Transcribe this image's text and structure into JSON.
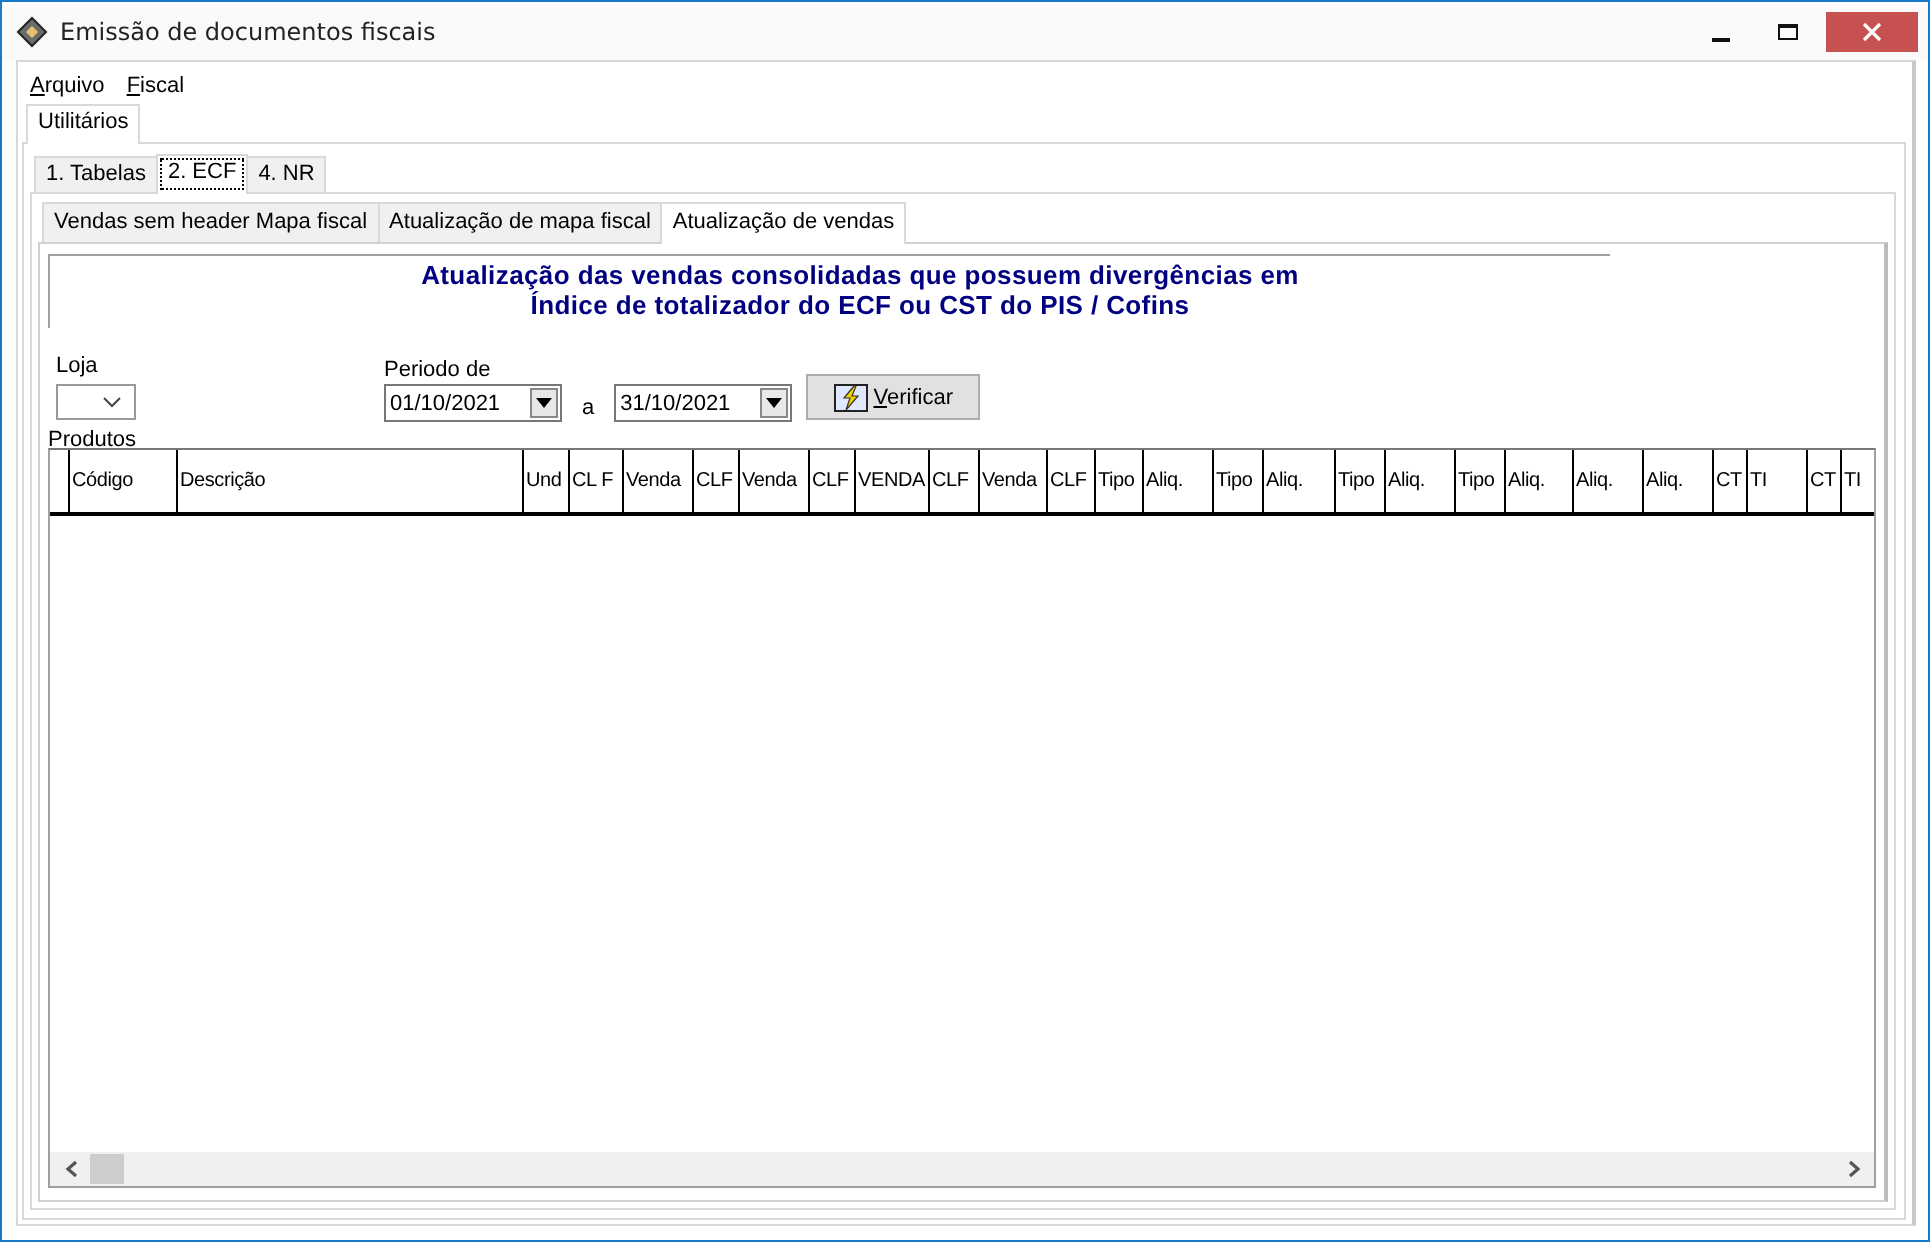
{
  "window": {
    "title": "Emissão de documentos fiscais"
  },
  "menu": [
    "Arquivo",
    "Fiscal"
  ],
  "outer_tabs": [
    {
      "label": "Utilitários",
      "selected": true
    }
  ],
  "tabs": [
    {
      "label": "1. Tabelas",
      "selected": false
    },
    {
      "label": "2. ECF",
      "selected": true
    },
    {
      "label": "4. NR",
      "selected": false
    }
  ],
  "subtabs": [
    {
      "label": "Vendas sem header Mapa fiscal",
      "selected": false
    },
    {
      "label": "Atualização de mapa fiscal",
      "selected": false
    },
    {
      "label": "Atualização de vendas",
      "selected": true
    }
  ],
  "heading": [
    "Atualização das vendas consolidadas que possuem divergências em",
    "Índice de totalizador do ECF ou CST do PIS / Cofins"
  ],
  "loja": {
    "label": "Loja"
  },
  "periodo": {
    "label": "Periodo  de",
    "from": "01/10/2021",
    "separator": "a",
    "to": "31/10/2021"
  },
  "verify_button": "Verificar",
  "table": {
    "label": "Produtos",
    "columns": [
      "Código",
      "Descrição",
      "Und",
      "CL F",
      "Venda",
      "CLF",
      "Venda",
      "CLF",
      "VENDA",
      "CLF",
      "Venda",
      "CLF",
      "Tipo",
      "Aliq.",
      "Tipo",
      "Aliq.",
      "Tipo",
      "Aliq.",
      "Tipo",
      "Aliq.",
      "Aliq.",
      "Aliq.",
      "CT",
      "TI",
      "CT",
      "TI"
    ]
  }
}
